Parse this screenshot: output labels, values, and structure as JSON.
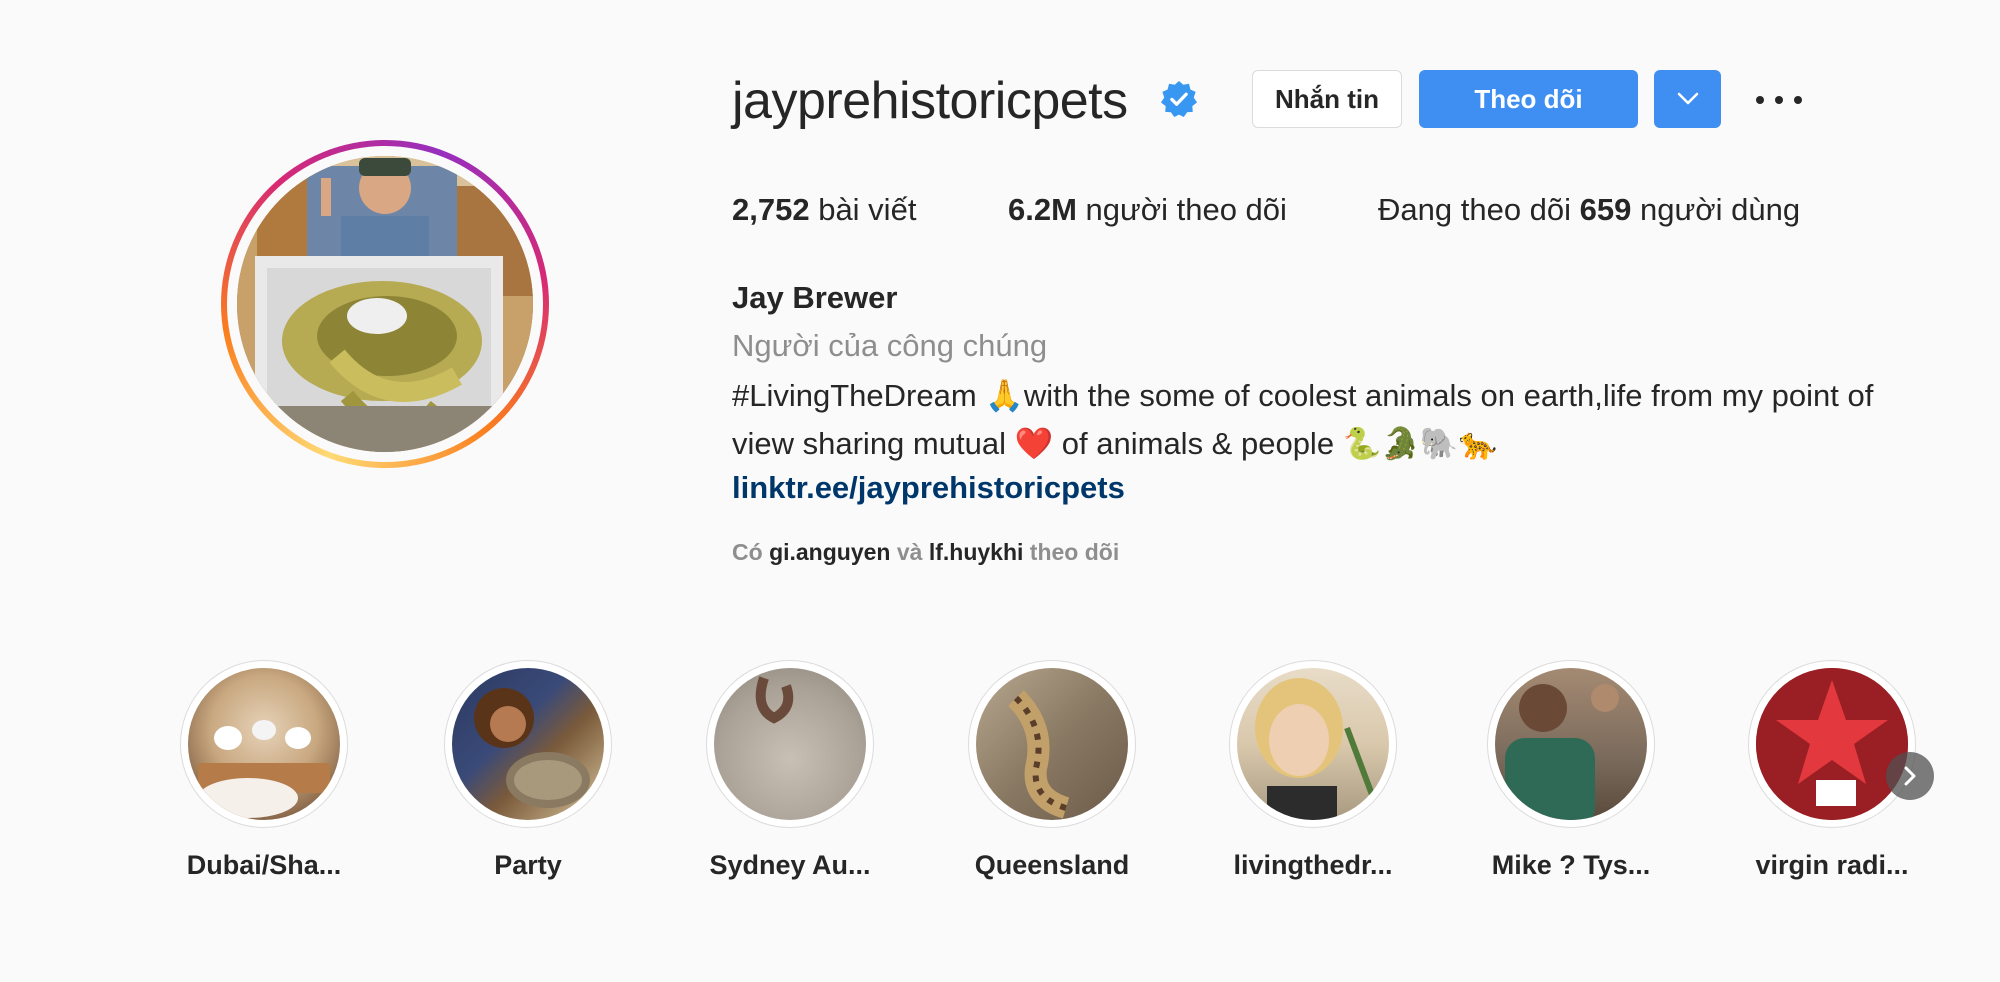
{
  "profile": {
    "username": "jayprehistoricpets",
    "verified_icon": "verified-badge-icon",
    "buttons": {
      "message": "Nhắn tin",
      "follow": "Theo dõi"
    },
    "stats": {
      "posts_count": "2,752",
      "posts_label": "bài viết",
      "followers_count": "6.2M",
      "followers_label": "người theo dõi",
      "following_prefix": "Đang theo dõi",
      "following_count": "659",
      "following_label": "người dùng"
    },
    "full_name": "Jay Brewer",
    "category": "Người của công chúng",
    "bio_line1": "#LivingTheDream 🙏with the some of coolest animals on earth,life from my point of",
    "bio_line2": "view sharing mutual ❤️ of animals & people 🐍🐊🐘🐆",
    "link": "linktr.ee/jayprehistoricpets",
    "followed_by": {
      "prefix": "Có",
      "user1": "gi.anguyen",
      "conj": "và",
      "user2": "lf.huykhi",
      "suffix": "theo dõi"
    }
  },
  "highlights": [
    {
      "label": "Dubai/Sha..."
    },
    {
      "label": "Party"
    },
    {
      "label": "Sydney Au..."
    },
    {
      "label": "Queensland"
    },
    {
      "label": "livingthedr..."
    },
    {
      "label": "Mike ? Tys..."
    },
    {
      "label": "virgin radi..."
    }
  ],
  "colors": {
    "accent_blue": "#3f8ff2",
    "link_blue": "#00376b",
    "muted": "#8e8e8e",
    "verified": "#3897f0"
  }
}
